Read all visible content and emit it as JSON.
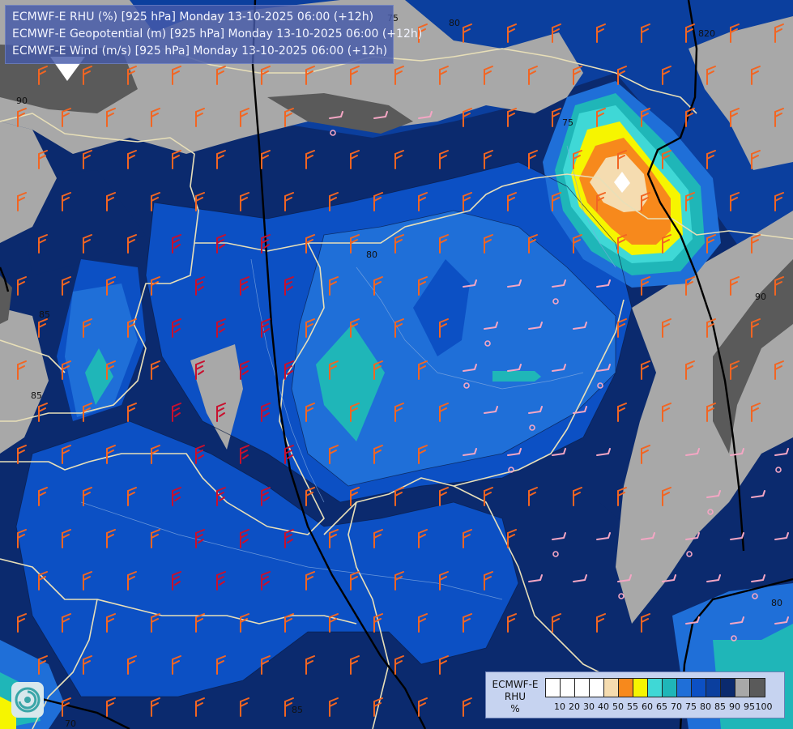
{
  "title": {
    "lines": [
      "ECMWF-E RHU (%) [925 hPa] Monday 13-10-2025 06:00 (+12h)",
      "ECMWF-E Geopotential (m) [925 hPa] Monday 13-10-2025 06:00 (+12h)",
      "ECMWF-E Wind (m/s) [925 hPa] Monday 13-10-2025 06:00 (+12h)"
    ]
  },
  "legend": {
    "title_lines": [
      "ECMWF-E",
      "RHU",
      "%"
    ],
    "levels": [
      "10",
      "20",
      "30",
      "40",
      "50",
      "55",
      "60",
      "65",
      "70",
      "75",
      "80",
      "85",
      "90",
      "95",
      "100"
    ],
    "colors": [
      "#ffffff",
      "#ffffff",
      "#ffffff",
      "#ffffff",
      "#f5dcb0",
      "#f7891c",
      "#f6f500",
      "#3fd8d6",
      "#1fb6b8",
      "#1f6fd8",
      "#0c50c4",
      "#0b3f9e",
      "#0b2a6e",
      "#a8a8a8",
      "#5a5a5a"
    ]
  },
  "contour_labels": [
    "75",
    "80",
    "90",
    "85",
    "820",
    "80",
    "75",
    "85",
    "80",
    "85",
    "70",
    "90"
  ],
  "logo": {
    "icon": "ecmwf-swirl-icon"
  },
  "colors": {
    "rhu_95": "#a8a8a8",
    "rhu_90": "#0b2a6e",
    "rhu_85": "#0b3f9e",
    "rhu_80": "#0c50c4",
    "rhu_75": "#1f6fd8",
    "rhu_70": "#1fb6b8",
    "rhu_65": "#3fd8d6",
    "rhu_60": "#f6f500",
    "rhu_55": "#f7891c",
    "rhu_50": "#f5dcb0",
    "border": "#e8dfb8",
    "geopotential": "#000000",
    "wind_strong": "#c8102e",
    "wind_medium": "#f26522",
    "wind_light": "#f4a6c4"
  }
}
